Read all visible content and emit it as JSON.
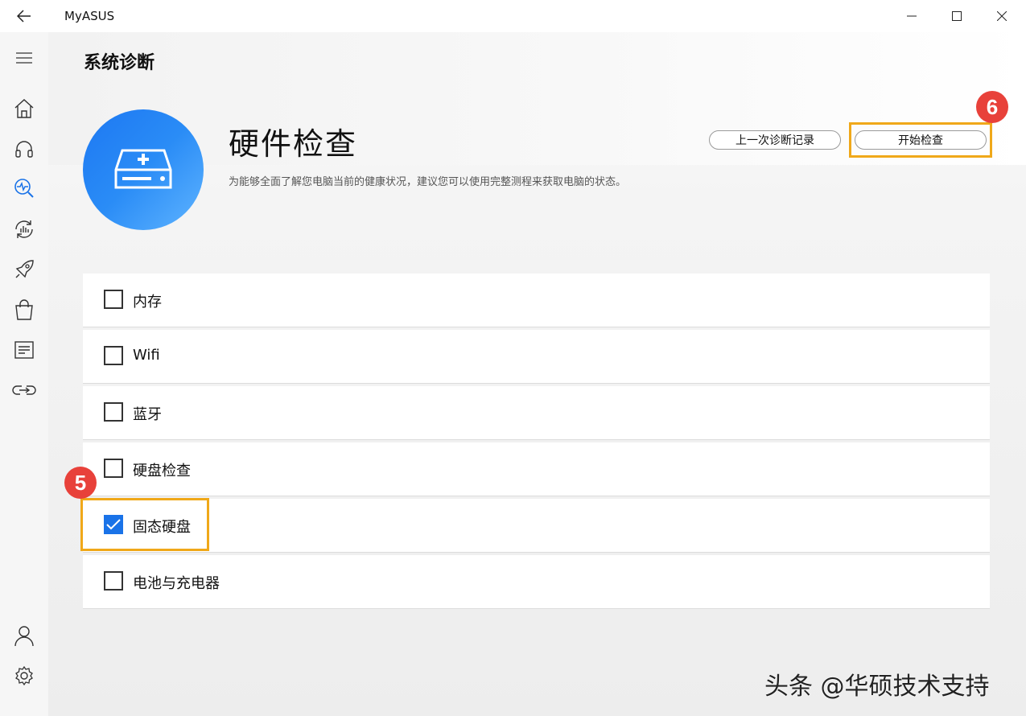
{
  "window": {
    "title": "MyASUS"
  },
  "sidebar": {
    "items": [
      {
        "icon": "menu-icon"
      },
      {
        "icon": "home-icon"
      },
      {
        "icon": "headset-icon"
      },
      {
        "icon": "diagnosis-icon",
        "active": true
      },
      {
        "icon": "system-refresh-icon"
      },
      {
        "icon": "rocket-icon"
      },
      {
        "icon": "shopping-bag-icon"
      },
      {
        "icon": "article-icon"
      },
      {
        "icon": "link-icon"
      },
      {
        "icon": "user-icon"
      },
      {
        "icon": "settings-gear-icon"
      }
    ]
  },
  "page": {
    "title": "系统诊断"
  },
  "section": {
    "title": "硬件检查",
    "description": "为能够全面了解您电脑当前的健康状况，建议您可以使用完整测程来获取电脑的状态。",
    "last_record_label": "上一次诊断记录",
    "start_label": "开始检查"
  },
  "checks": [
    {
      "label": "内存",
      "checked": false
    },
    {
      "label": "Wifi",
      "checked": false
    },
    {
      "label": "蓝牙",
      "checked": false
    },
    {
      "label": "硬盘检查",
      "checked": false
    },
    {
      "label": "固态硬盘",
      "checked": true
    },
    {
      "label": "电池与充电器",
      "checked": false
    }
  ],
  "annotations": {
    "step5": "5",
    "step6": "6",
    "highlight_color": "#f0a819",
    "badge_color": "#e8413a"
  },
  "colors": {
    "accent": "#1a73e8"
  },
  "watermark": "头条 @华硕技术支持"
}
